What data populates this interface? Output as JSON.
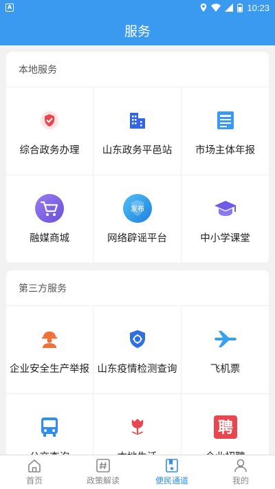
{
  "status_bar": {
    "app_icon_letter": "A",
    "time": "10:23"
  },
  "header": {
    "title": "服务"
  },
  "sections": [
    {
      "title": "本地服务",
      "items": [
        {
          "label": "综合政务办理",
          "icon": "shield-check-icon"
        },
        {
          "label": "山东政务平邑站",
          "icon": "buildings-icon"
        },
        {
          "label": "市场主体年报",
          "icon": "document-icon"
        },
        {
          "label": "融媒商城",
          "icon": "shopping-cart-icon"
        },
        {
          "label": "网络辟谣平台",
          "icon": "badge-icon",
          "badge_text": "发布"
        },
        {
          "label": "中小学课堂",
          "icon": "graduation-cap-icon"
        }
      ]
    },
    {
      "title": "第三方服务",
      "items": [
        {
          "label": "企业安全生产举报",
          "icon": "safety-worker-icon"
        },
        {
          "label": "山东疫情检测查询",
          "icon": "shield-scan-icon"
        },
        {
          "label": "飞机票",
          "icon": "airplane-icon"
        },
        {
          "label": "公交查询",
          "icon": "bus-icon"
        },
        {
          "label": "本地生活",
          "icon": "tulip-icon"
        },
        {
          "label": "企业招聘",
          "icon": "recruit-icon",
          "badge_text": "聘"
        }
      ]
    }
  ],
  "tabbar": {
    "tabs": [
      {
        "label": "首页",
        "icon": "home-icon",
        "active": false
      },
      {
        "label": "政策解读",
        "icon": "hashtag-icon",
        "active": false
      },
      {
        "label": "便民通道",
        "icon": "bookmark-star-icon",
        "active": true
      },
      {
        "label": "我的",
        "icon": "user-icon",
        "active": false
      }
    ]
  },
  "colors": {
    "primary": "#3a9af0",
    "active_tab": "#2f8ef0",
    "red": "#e9474f",
    "orange": "#f0713a",
    "purple": "#7c5ce6",
    "sky": "#36a0f2"
  }
}
